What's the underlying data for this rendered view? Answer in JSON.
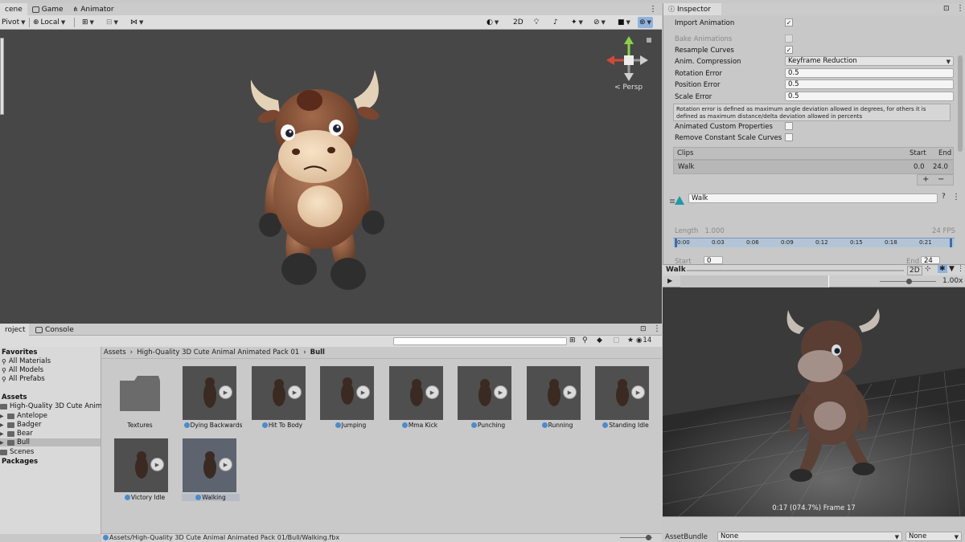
{
  "scene": {
    "tabs": [
      {
        "label": "cene",
        "active": true
      },
      {
        "label": "Game",
        "active": false
      },
      {
        "label": "Animator",
        "active": false
      }
    ],
    "toolbar": {
      "pivot": "Pivot",
      "local": "Local",
      "mode_2d": "2D"
    },
    "persp_label": "< Persp",
    "gizmo_axes": {
      "x": "x",
      "y": "y",
      "z": "z"
    }
  },
  "project": {
    "tabs": [
      {
        "label": "roject",
        "active": true
      },
      {
        "label": "Console",
        "active": false
      }
    ],
    "search_placeholder": "",
    "visible_count": "14",
    "favorites": {
      "title": "Favorites",
      "items": [
        "All Materials",
        "All Models",
        "All Prefabs"
      ]
    },
    "assets_tree": {
      "title": "Assets",
      "root": "High-Quality 3D Cute Anima",
      "folders": [
        "Antelope",
        "Badger",
        "Bear",
        "Bull"
      ],
      "selected_folder": "Bull",
      "scenes": "Scenes"
    },
    "packages": "Packages",
    "breadcrumb": [
      "Assets",
      "High-Quality 3D Cute Animal Animated Pack 01",
      "Bull"
    ],
    "assets": [
      {
        "label": "Textures",
        "type": "folder"
      },
      {
        "label": "Dying Backwards",
        "type": "model"
      },
      {
        "label": "Hit To Body",
        "type": "model"
      },
      {
        "label": "Jumping",
        "type": "model"
      },
      {
        "label": "Mma Kick",
        "type": "model"
      },
      {
        "label": "Punching",
        "type": "model"
      },
      {
        "label": "Running",
        "type": "model"
      },
      {
        "label": "Standing Idle",
        "type": "model"
      },
      {
        "label": "Victory Idle",
        "type": "model"
      },
      {
        "label": "Walking",
        "type": "model",
        "selected": true
      }
    ],
    "status_path": "Assets/High-Quality 3D Cute Animal Animated Pack 01/Bull/Walking.fbx"
  },
  "inspector": {
    "tab_label": "Inspector",
    "import_animation": {
      "label": "Import Animation",
      "checked": true
    },
    "bake_animations": {
      "label": "Bake Animations",
      "checked": false
    },
    "resample_curves": {
      "label": "Resample Curves",
      "checked": true
    },
    "anim_compression": {
      "label": "Anim. Compression",
      "value": "Keyframe Reduction"
    },
    "rotation_error": {
      "label": "Rotation Error",
      "value": "0.5"
    },
    "position_error": {
      "label": "Position Error",
      "value": "0.5"
    },
    "scale_error": {
      "label": "Scale Error",
      "value": "0.5"
    },
    "help_text": "Rotation error is defined as maximum angle deviation allowed in degrees, for others it is defined as maximum distance/delta deviation allowed in percents",
    "animated_custom_properties": {
      "label": "Animated Custom Properties",
      "checked": false
    },
    "remove_constant_scale_curves": {
      "label": "Remove Constant Scale Curves",
      "checked": false
    },
    "clips": {
      "header": "Clips",
      "col_start": "Start",
      "col_end": "End",
      "rows": [
        {
          "name": "Walk",
          "start": "0.0",
          "end": "24.0"
        }
      ],
      "add": "+",
      "remove": "−"
    },
    "clip_name": "Walk",
    "length_label": "Length",
    "length_value": "1.000",
    "fps": "24 FPS",
    "ticks": [
      "0:00",
      "0:03",
      "0:06",
      "0:09",
      "0:12",
      "0:15",
      "0:18",
      "0:21"
    ],
    "start_label": "Start",
    "start_value": "0",
    "end_label": "End",
    "end_value": "24"
  },
  "preview": {
    "title": "Walk",
    "mode_2d": "2D",
    "speed": "1.00x",
    "status": "0:17 (074.7%) Frame 17"
  },
  "asset_bundle": {
    "label": "AssetBundle",
    "name": "None",
    "variant": "None"
  },
  "colors": {
    "viewport_bg": "#474747",
    "panel_bg": "#c8c8c8",
    "selection": "#5d6470",
    "accent": "#4a8ccc"
  }
}
